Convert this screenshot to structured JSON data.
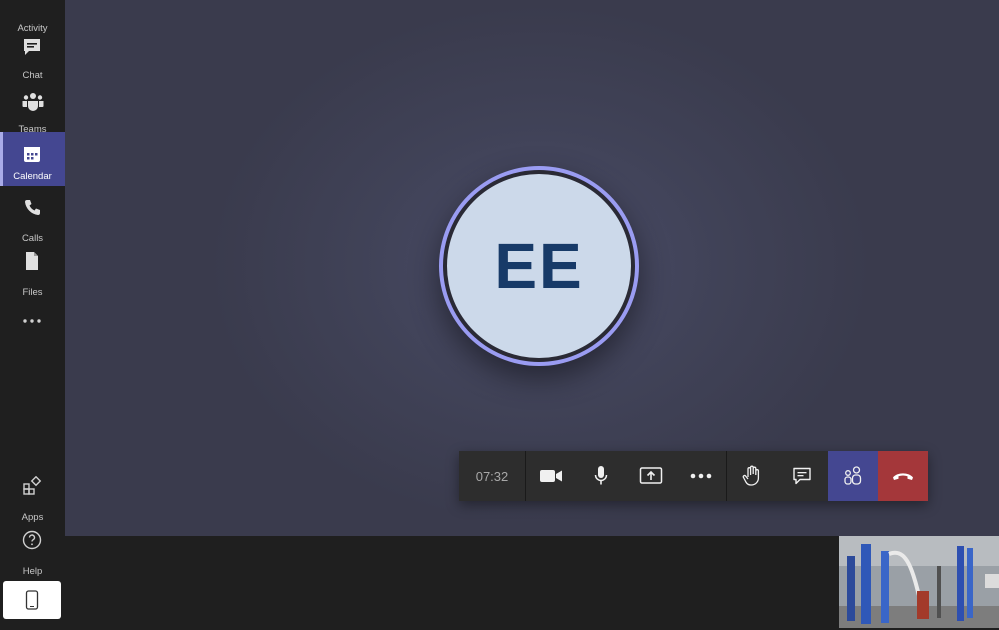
{
  "sidebar": {
    "items": [
      {
        "label": "Activity",
        "icon": "bell-icon"
      },
      {
        "label": "Chat",
        "icon": "chat-icon"
      },
      {
        "label": "Teams",
        "icon": "teams-icon"
      },
      {
        "label": "Calendar",
        "icon": "calendar-icon",
        "active": true
      },
      {
        "label": "Calls",
        "icon": "phone-icon"
      },
      {
        "label": "Files",
        "icon": "file-icon"
      }
    ],
    "more_icon": "more-horizontal-icon",
    "apps_label": "Apps",
    "help_label": "Help",
    "device_icon": "mobile-device-icon"
  },
  "call": {
    "avatar_initials": "EE",
    "timer": "07:32",
    "buttons": [
      {
        "name": "camera",
        "icon": "video-camera-icon"
      },
      {
        "name": "mic",
        "icon": "microphone-icon"
      },
      {
        "name": "share",
        "icon": "share-screen-icon"
      },
      {
        "name": "more",
        "icon": "more-horizontal-icon"
      },
      {
        "name": "raise-hand",
        "icon": "hand-icon"
      },
      {
        "name": "chat",
        "icon": "chat-icon"
      },
      {
        "name": "participants",
        "icon": "people-icon"
      },
      {
        "name": "hang-up",
        "icon": "hang-up-icon"
      }
    ]
  },
  "colors": {
    "accent": "#444791",
    "ring": "#9a9cf2",
    "avatar_bg": "#ccd9ea",
    "avatar_text": "#173a68",
    "hangup": "#a4373a",
    "stage": "#404257"
  }
}
